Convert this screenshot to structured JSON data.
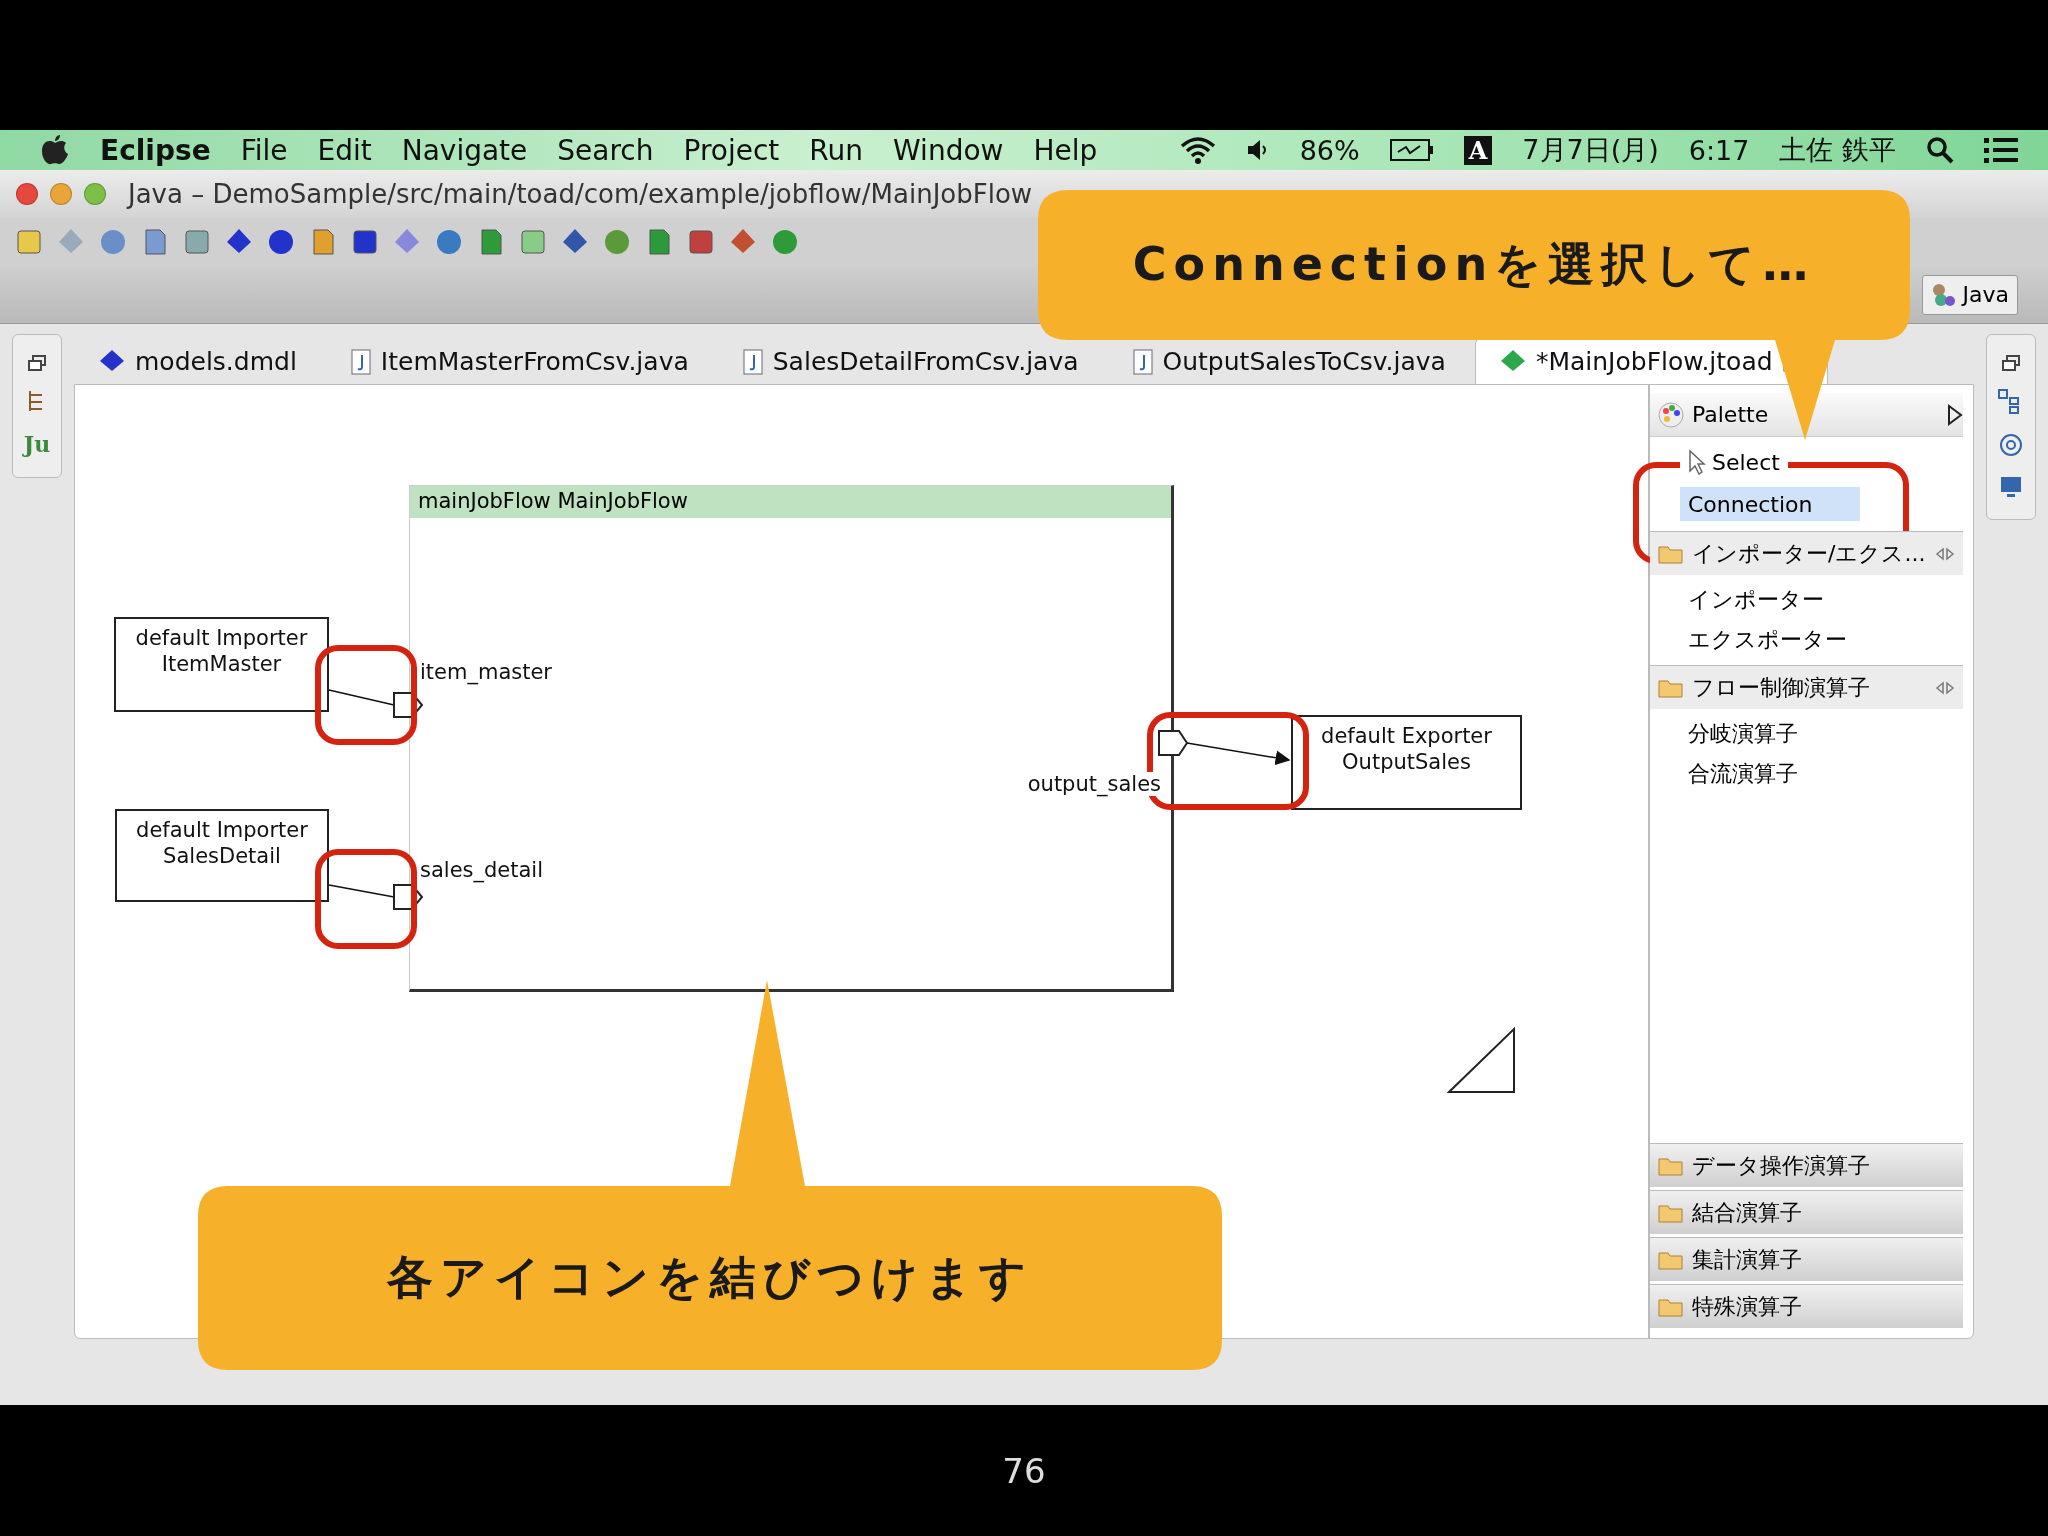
{
  "menu_bar": {
    "app": "Eclipse",
    "items": [
      "File",
      "Edit",
      "Navigate",
      "Search",
      "Project",
      "Run",
      "Window",
      "Help"
    ],
    "battery": "86%",
    "input_mode": "A",
    "date": "7月7日(月)",
    "time": "6:17",
    "user": "土佐 鉄平"
  },
  "window": {
    "title": "Java – DemoSample/src/main/toad/com/example/jobflow/MainJobFlow"
  },
  "perspective": "Java",
  "left_trim": {
    "label": "Ju"
  },
  "tabs": [
    {
      "label": "models.dmdl",
      "kind": "model",
      "selected": false
    },
    {
      "label": "ItemMasterFromCsv.java",
      "kind": "java",
      "selected": false
    },
    {
      "label": "SalesDetailFromCsv.java",
      "kind": "java",
      "selected": false
    },
    {
      "label": "OutputSalesToCsv.java",
      "kind": "java",
      "selected": false
    },
    {
      "label": "*MainJobFlow.jtoad",
      "kind": "flow",
      "selected": true
    }
  ],
  "diagram": {
    "flow": {
      "title": "mainJobFlow MainJobFlow"
    },
    "nodes": [
      {
        "text": "default Importer\nItemMaster"
      },
      {
        "text": "default Importer\nSalesDetail"
      },
      {
        "text": "default Exporter\nOutputSales"
      }
    ],
    "ports": [
      {
        "kind": "input",
        "label": "item_master"
      },
      {
        "kind": "input",
        "label": "sales_detail"
      },
      {
        "kind": "output",
        "label": "output_sales"
      }
    ]
  },
  "palette": {
    "title": "Palette",
    "tools": [
      {
        "kind": "select",
        "label": "Select",
        "selected": false
      },
      {
        "kind": "connection",
        "label": "Connection",
        "selected": true
      }
    ],
    "drawers": [
      {
        "label": "インポーター/エクス...",
        "expanded": true,
        "items": [
          "インポーター",
          "エクスポーター"
        ]
      },
      {
        "label": "フロー制御演算子",
        "expanded": true,
        "items": [
          "分岐演算子",
          "合流演算子"
        ]
      },
      {
        "label": "データ操作演算子",
        "expanded": false
      },
      {
        "label": "結合演算子",
        "expanded": false
      },
      {
        "label": "集計演算子",
        "expanded": false
      },
      {
        "label": "特殊演算子",
        "expanded": false
      }
    ]
  },
  "callouts": [
    {
      "text": "Connectionを選択して…"
    },
    {
      "text": "各アイコンを結びつけます"
    }
  ],
  "slide_number": "76"
}
